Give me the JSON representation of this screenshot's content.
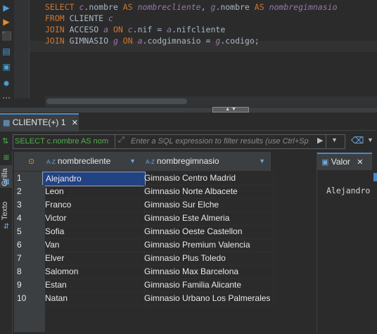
{
  "toolbar": {
    "icons": [
      "run-statement-icon",
      "run-script-icon",
      "explain-plan-icon",
      "load-script-icon",
      "terminal-icon",
      "settings-icon",
      "more-icon"
    ]
  },
  "editor": {
    "lines": [
      [
        [
          "kw",
          "SELECT "
        ],
        [
          "al",
          "c"
        ],
        [
          "id",
          ".nombre "
        ],
        [
          "kw",
          "AS "
        ],
        [
          "al",
          "nombrecliente"
        ],
        [
          "id",
          ", "
        ],
        [
          "al",
          "g"
        ],
        [
          "id",
          ".nombre "
        ],
        [
          "kw",
          "AS "
        ],
        [
          "al",
          "nombregimnasio"
        ]
      ],
      [
        [
          "kw",
          "FROM "
        ],
        [
          "id",
          "CLIENTE "
        ],
        [
          "al",
          "c"
        ]
      ],
      [
        [
          "kw",
          "JOIN "
        ],
        [
          "id",
          "ACCESO "
        ],
        [
          "al",
          "a "
        ],
        [
          "kw",
          "ON "
        ],
        [
          "al",
          "c"
        ],
        [
          "id",
          ".nif = "
        ],
        [
          "al",
          "a"
        ],
        [
          "id",
          ".nifcliente"
        ]
      ],
      [
        [
          "kw",
          "JOIN "
        ],
        [
          "id",
          "GIMNASIO "
        ],
        [
          "al",
          "g "
        ],
        [
          "kw",
          "ON "
        ],
        [
          "al",
          "a"
        ],
        [
          "id",
          ".codgimnasio = "
        ],
        [
          "al",
          "g"
        ],
        [
          "id",
          ".codigo;"
        ]
      ]
    ]
  },
  "results_tab": {
    "label": "CLIENTE(+) 1",
    "close": "✕"
  },
  "filter": {
    "sql_text": "SELECT c.nombre AS nom",
    "placeholder": "Enter a SQL expression to filter results (use Ctrl+Sp"
  },
  "side_tabs": {
    "grid": "Grilla",
    "text": "Texto"
  },
  "grid": {
    "columns": [
      {
        "type": "A-Z",
        "name": "nombrecliente"
      },
      {
        "type": "A-Z",
        "name": "nombregimnasio"
      }
    ],
    "rows": [
      [
        "1",
        "Alejandro",
        "Gimnasio Centro Madrid"
      ],
      [
        "2",
        "Leon",
        "Gimnasio Norte Albacete"
      ],
      [
        "3",
        "Franco",
        "Gimnasio Sur Elche"
      ],
      [
        "4",
        "Victor",
        "Gimnasio Este Almeria"
      ],
      [
        "5",
        "Sofia",
        "Gimnasio Oeste Castellon"
      ],
      [
        "6",
        "Van",
        "Gimnasio Premium Valencia"
      ],
      [
        "7",
        "Elver",
        "Gimnasio Plus Toledo"
      ],
      [
        "8",
        "Salomon",
        "Gimnasio Max Barcelona"
      ],
      [
        "9",
        "Estan",
        "Gimnasio Familia Alicante"
      ],
      [
        "10",
        "Natan",
        "Gimnasio Urbano Los Palmerales"
      ]
    ],
    "selected_row": 0
  },
  "value_panel": {
    "tab_label": "Valor",
    "close": "✕",
    "value": "Alejandro"
  },
  "colors": {
    "accent": "#4a88c7",
    "keyword": "#cc7832",
    "alias": "#9876aa",
    "selection": "#214283",
    "filter_text": "#51b04d"
  }
}
